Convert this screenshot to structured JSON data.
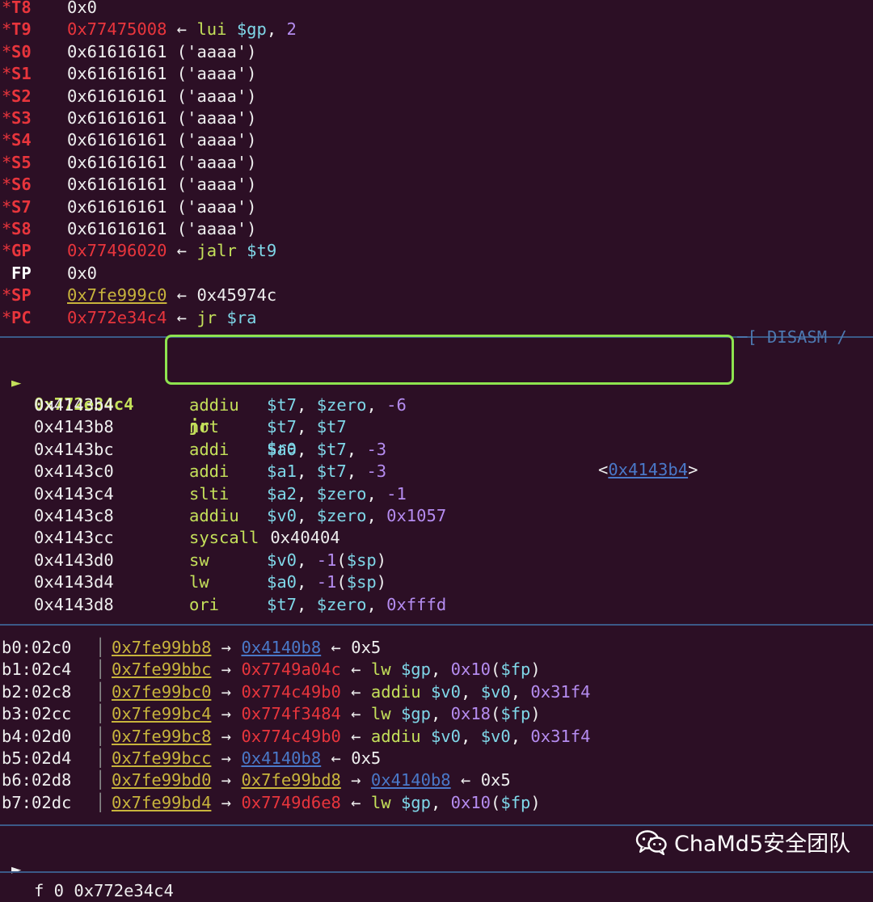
{
  "registers": [
    {
      "name": "T8",
      "star": true,
      "value": "0x0",
      "vclass": "wht",
      "rest": []
    },
    {
      "name": "T9",
      "star": true,
      "value": "0x77475008",
      "vclass": "red",
      "rest": [
        {
          "t": " ← ",
          "c": "wht"
        },
        {
          "t": "lui ",
          "c": "grn"
        },
        {
          "t": "$gp",
          "c": "cyn"
        },
        {
          "t": ", ",
          "c": "wht"
        },
        {
          "t": "2",
          "c": "pur"
        }
      ]
    },
    {
      "name": "S0",
      "star": true,
      "value": "0x61616161 ('aaaa')",
      "vclass": "wht",
      "rest": []
    },
    {
      "name": "S1",
      "star": true,
      "value": "0x61616161 ('aaaa')",
      "vclass": "wht",
      "rest": []
    },
    {
      "name": "S2",
      "star": true,
      "value": "0x61616161 ('aaaa')",
      "vclass": "wht",
      "rest": []
    },
    {
      "name": "S3",
      "star": true,
      "value": "0x61616161 ('aaaa')",
      "vclass": "wht",
      "rest": []
    },
    {
      "name": "S4",
      "star": true,
      "value": "0x61616161 ('aaaa')",
      "vclass": "wht",
      "rest": []
    },
    {
      "name": "S5",
      "star": true,
      "value": "0x61616161 ('aaaa')",
      "vclass": "wht",
      "rest": []
    },
    {
      "name": "S6",
      "star": true,
      "value": "0x61616161 ('aaaa')",
      "vclass": "wht",
      "rest": []
    },
    {
      "name": "S7",
      "star": true,
      "value": "0x61616161 ('aaaa')",
      "vclass": "wht",
      "rest": []
    },
    {
      "name": "S8",
      "star": true,
      "value": "0x61616161 ('aaaa')",
      "vclass": "wht",
      "rest": []
    },
    {
      "name": "GP",
      "star": true,
      "value": "0x77496020",
      "vclass": "red",
      "rest": [
        {
          "t": " ← ",
          "c": "wht"
        },
        {
          "t": "jalr ",
          "c": "grn"
        },
        {
          "t": "$t9",
          "c": "cyn"
        }
      ]
    },
    {
      "name": "FP",
      "star": false,
      "value": "0x0",
      "vclass": "wht",
      "rest": []
    },
    {
      "name": "SP",
      "star": true,
      "value": "0x7fe999c0",
      "vclass": "yel",
      "rest": [
        {
          "t": " ← ",
          "c": "wht"
        },
        {
          "t": "0x45974c",
          "c": "wht"
        }
      ]
    },
    {
      "name": "PC",
      "star": true,
      "value": "0x772e34c4",
      "vclass": "red",
      "rest": [
        {
          "t": " ← ",
          "c": "wht"
        },
        {
          "t": "jr ",
          "c": "grn"
        },
        {
          "t": "$ra",
          "c": "cyn"
        }
      ]
    }
  ],
  "disasm": {
    "header": "─[ DISASM /",
    "current": {
      "marker": "►",
      "addr": "0x772e34c4",
      "mnemonic": "jr",
      "operand": "$ra",
      "target_prefix": "<",
      "target": "0x4143b4",
      "target_suffix": ">",
      "down_arrow": "↓"
    },
    "lines": [
      {
        "addr": "0x4143b4",
        "mn": "addiu",
        "ops": [
          {
            "t": "$t7",
            "c": "cyn"
          },
          {
            "t": ", ",
            "c": "wht"
          },
          {
            "t": "$zero",
            "c": "cyn"
          },
          {
            "t": ", ",
            "c": "wht"
          },
          {
            "t": "-6",
            "c": "pur"
          }
        ]
      },
      {
        "addr": "0x4143b8",
        "mn": "not",
        "ops": [
          {
            "t": "$t7",
            "c": "cyn"
          },
          {
            "t": ", ",
            "c": "wht"
          },
          {
            "t": "$t7",
            "c": "cyn"
          }
        ]
      },
      {
        "addr": "0x4143bc",
        "mn": "addi",
        "ops": [
          {
            "t": "$a0",
            "c": "cyn"
          },
          {
            "t": ", ",
            "c": "wht"
          },
          {
            "t": "$t7",
            "c": "cyn"
          },
          {
            "t": ", ",
            "c": "wht"
          },
          {
            "t": "-3",
            "c": "pur"
          }
        ]
      },
      {
        "addr": "0x4143c0",
        "mn": "addi",
        "ops": [
          {
            "t": "$a1",
            "c": "cyn"
          },
          {
            "t": ", ",
            "c": "wht"
          },
          {
            "t": "$t7",
            "c": "cyn"
          },
          {
            "t": ", ",
            "c": "wht"
          },
          {
            "t": "-3",
            "c": "pur"
          }
        ]
      },
      {
        "addr": "0x4143c4",
        "mn": "slti",
        "ops": [
          {
            "t": "$a2",
            "c": "cyn"
          },
          {
            "t": ", ",
            "c": "wht"
          },
          {
            "t": "$zero",
            "c": "cyn"
          },
          {
            "t": ", ",
            "c": "wht"
          },
          {
            "t": "-1",
            "c": "pur"
          }
        ]
      },
      {
        "addr": "0x4143c8",
        "mn": "addiu",
        "ops": [
          {
            "t": "$v0",
            "c": "cyn"
          },
          {
            "t": ", ",
            "c": "wht"
          },
          {
            "t": "$zero",
            "c": "cyn"
          },
          {
            "t": ", ",
            "c": "wht"
          },
          {
            "t": "0x1057",
            "c": "pur"
          }
        ]
      },
      {
        "addr": "0x4143cc",
        "mn": "syscall",
        "ops": [
          {
            "t": " 0x40404",
            "c": "wht"
          }
        ]
      },
      {
        "addr": "0x4143d0",
        "mn": "sw",
        "ops": [
          {
            "t": "$v0",
            "c": "cyn"
          },
          {
            "t": ", ",
            "c": "wht"
          },
          {
            "t": "-1",
            "c": "pur"
          },
          {
            "t": "(",
            "c": "wht"
          },
          {
            "t": "$sp",
            "c": "cyn"
          },
          {
            "t": ")",
            "c": "wht"
          }
        ]
      },
      {
        "addr": "0x4143d4",
        "mn": "lw",
        "ops": [
          {
            "t": "$a0",
            "c": "cyn"
          },
          {
            "t": ", ",
            "c": "wht"
          },
          {
            "t": "-1",
            "c": "pur"
          },
          {
            "t": "(",
            "c": "wht"
          },
          {
            "t": "$sp",
            "c": "cyn"
          },
          {
            "t": ")",
            "c": "wht"
          }
        ]
      },
      {
        "addr": "0x4143d8",
        "mn": "ori",
        "ops": [
          {
            "t": "$t7",
            "c": "cyn"
          },
          {
            "t": ", ",
            "c": "wht"
          },
          {
            "t": "$zero",
            "c": "cyn"
          },
          {
            "t": ", ",
            "c": "wht"
          },
          {
            "t": "0xfffd",
            "c": "pur"
          }
        ]
      }
    ]
  },
  "stack": [
    {
      "label": "b0:02c0",
      "parts": [
        {
          "t": "0x7fe99bb8",
          "c": "yel"
        },
        {
          "t": " → ",
          "c": "wht"
        },
        {
          "t": "0x4140b8",
          "c": "blu"
        },
        {
          "t": " ← ",
          "c": "wht"
        },
        {
          "t": "0x5",
          "c": "wht"
        }
      ]
    },
    {
      "label": "b1:02c4",
      "parts": [
        {
          "t": "0x7fe99bbc",
          "c": "yel"
        },
        {
          "t": " → ",
          "c": "wht"
        },
        {
          "t": "0x7749a04c",
          "c": "red"
        },
        {
          "t": " ← ",
          "c": "wht"
        },
        {
          "t": "lw ",
          "c": "grn"
        },
        {
          "t": "$gp",
          "c": "cyn"
        },
        {
          "t": ", ",
          "c": "wht"
        },
        {
          "t": "0x10",
          "c": "pur"
        },
        {
          "t": "(",
          "c": "wht"
        },
        {
          "t": "$fp",
          "c": "cyn"
        },
        {
          "t": ")",
          "c": "wht"
        }
      ]
    },
    {
      "label": "b2:02c8",
      "parts": [
        {
          "t": "0x7fe99bc0",
          "c": "yel"
        },
        {
          "t": " → ",
          "c": "wht"
        },
        {
          "t": "0x774c49b0",
          "c": "red"
        },
        {
          "t": " ← ",
          "c": "wht"
        },
        {
          "t": "addiu ",
          "c": "grn"
        },
        {
          "t": "$v0",
          "c": "cyn"
        },
        {
          "t": ", ",
          "c": "wht"
        },
        {
          "t": "$v0",
          "c": "cyn"
        },
        {
          "t": ", ",
          "c": "wht"
        },
        {
          "t": "0x31f4",
          "c": "pur"
        }
      ]
    },
    {
      "label": "b3:02cc",
      "parts": [
        {
          "t": "0x7fe99bc4",
          "c": "yel"
        },
        {
          "t": " → ",
          "c": "wht"
        },
        {
          "t": "0x774f3484",
          "c": "red"
        },
        {
          "t": " ← ",
          "c": "wht"
        },
        {
          "t": "lw ",
          "c": "grn"
        },
        {
          "t": "$gp",
          "c": "cyn"
        },
        {
          "t": ", ",
          "c": "wht"
        },
        {
          "t": "0x18",
          "c": "pur"
        },
        {
          "t": "(",
          "c": "wht"
        },
        {
          "t": "$fp",
          "c": "cyn"
        },
        {
          "t": ")",
          "c": "wht"
        }
      ]
    },
    {
      "label": "b4:02d0",
      "parts": [
        {
          "t": "0x7fe99bc8",
          "c": "yel"
        },
        {
          "t": " → ",
          "c": "wht"
        },
        {
          "t": "0x774c49b0",
          "c": "red"
        },
        {
          "t": " ← ",
          "c": "wht"
        },
        {
          "t": "addiu ",
          "c": "grn"
        },
        {
          "t": "$v0",
          "c": "cyn"
        },
        {
          "t": ", ",
          "c": "wht"
        },
        {
          "t": "$v0",
          "c": "cyn"
        },
        {
          "t": ", ",
          "c": "wht"
        },
        {
          "t": "0x31f4",
          "c": "pur"
        }
      ]
    },
    {
      "label": "b5:02d4",
      "parts": [
        {
          "t": "0x7fe99bcc",
          "c": "yel"
        },
        {
          "t": " → ",
          "c": "wht"
        },
        {
          "t": "0x4140b8",
          "c": "blu"
        },
        {
          "t": " ← ",
          "c": "wht"
        },
        {
          "t": "0x5",
          "c": "wht"
        }
      ]
    },
    {
      "label": "b6:02d8",
      "parts": [
        {
          "t": "0x7fe99bd0",
          "c": "yel"
        },
        {
          "t": " → ",
          "c": "wht"
        },
        {
          "t": "0x7fe99bd8",
          "c": "yel"
        },
        {
          "t": " → ",
          "c": "wht"
        },
        {
          "t": "0x4140b8",
          "c": "blu"
        },
        {
          "t": " ← ",
          "c": "wht"
        },
        {
          "t": "0x5",
          "c": "wht"
        }
      ]
    },
    {
      "label": "b7:02dc",
      "parts": [
        {
          "t": "0x7fe99bd4",
          "c": "yel"
        },
        {
          "t": " → ",
          "c": "wht"
        },
        {
          "t": "0x7749d6e8",
          "c": "red"
        },
        {
          "t": " ← ",
          "c": "wht"
        },
        {
          "t": "lw ",
          "c": "grn"
        },
        {
          "t": "$gp",
          "c": "cyn"
        },
        {
          "t": ", ",
          "c": "wht"
        },
        {
          "t": "0x10",
          "c": "pur"
        },
        {
          "t": "(",
          "c": "wht"
        },
        {
          "t": "$fp",
          "c": "cyn"
        },
        {
          "t": ")",
          "c": "wht"
        }
      ]
    }
  ],
  "backtrace": {
    "marker": "►",
    "text": "f 0 0x772e34c4"
  },
  "watermark": {
    "icon": "wechat-icon",
    "text": "ChaMd5安全团队"
  },
  "colors": {
    "background": "#2c0f25",
    "highlight_border": "#8ee34f",
    "separator": "#3b5a88"
  }
}
